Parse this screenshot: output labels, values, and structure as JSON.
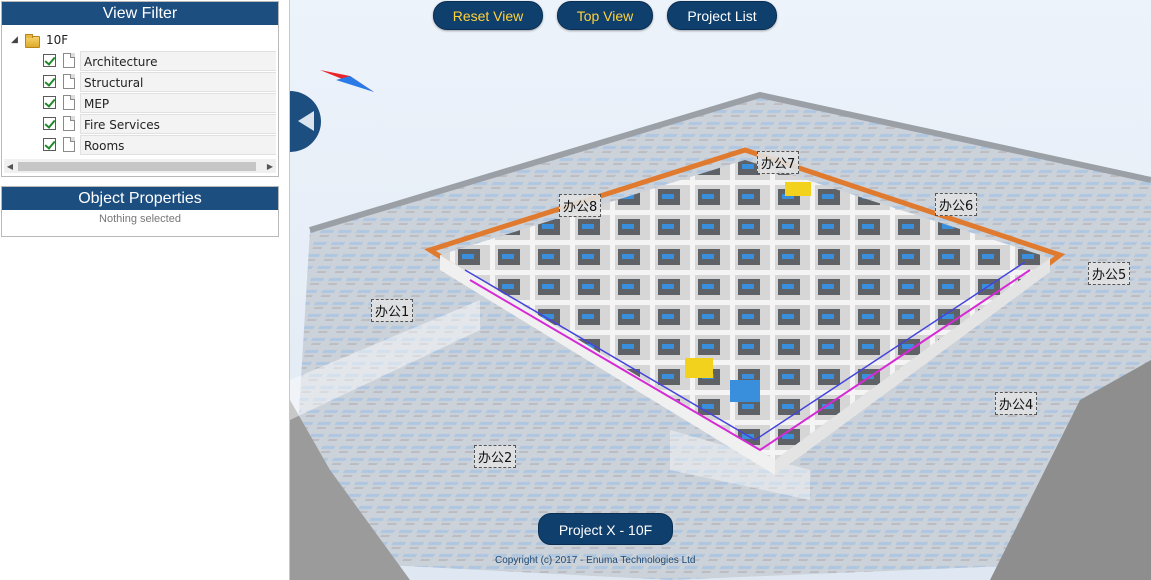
{
  "view_filter": {
    "title": "View Filter",
    "root_label": "10F",
    "items": [
      {
        "label": "Architecture",
        "checked": true
      },
      {
        "label": "Structural",
        "checked": true
      },
      {
        "label": "MEP",
        "checked": true
      },
      {
        "label": "Fire Services",
        "checked": true
      },
      {
        "label": "Rooms",
        "checked": true
      }
    ]
  },
  "object_properties": {
    "title": "Object Properties",
    "status": "Nothing selected"
  },
  "toolbar": {
    "reset_view": "Reset View",
    "top_view": "Top View",
    "project_list": "Project List"
  },
  "rooms": {
    "r1": "办公1",
    "r2": "办公2",
    "r4": "办公4",
    "r5": "办公5",
    "r6": "办公6",
    "r7": "办公7",
    "r8": "办公8"
  },
  "project_title": "Project X - 10F",
  "copyright": "Copyright (c) 2017 - Enuma Technologies Ltd",
  "colors": {
    "brand": "#1c4e80",
    "button_text_accent": "#ffd23a",
    "viewport_bg": "#eaf2fb"
  }
}
